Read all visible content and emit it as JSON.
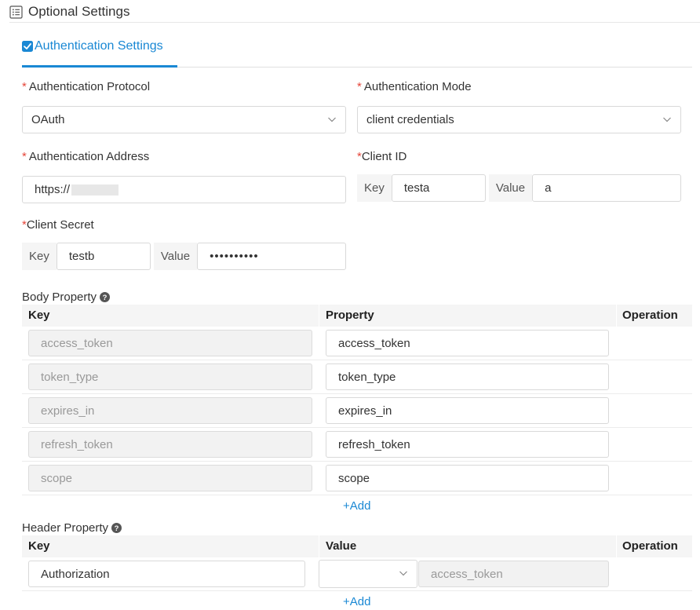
{
  "section": {
    "title": "Optional Settings",
    "icon": "list-icon"
  },
  "tab": {
    "label": "Authentication Settings",
    "checked": true,
    "color": "#1a88d4"
  },
  "fields": {
    "protocol": {
      "required": "*",
      "label": "Authentication Protocol",
      "value": "OAuth"
    },
    "mode": {
      "required": "*",
      "label": "Authentication Mode",
      "value": "client credentials"
    },
    "address": {
      "required": "*",
      "label": "Authentication Address",
      "value": "https://"
    },
    "client_id": {
      "required": "*",
      "label": "Client ID",
      "key_label": "Key",
      "key_value": "testa",
      "value_label": "Value",
      "value_value": "a"
    },
    "client_secret": {
      "required": "*",
      "label": "Client Secret",
      "key_label": "Key",
      "key_value": "testb",
      "value_label": "Value",
      "value_value": "••••••••••"
    }
  },
  "body_property": {
    "title": "Body Property",
    "columns": [
      "Key",
      "Property",
      "Operation"
    ],
    "rows": [
      {
        "key": "access_token",
        "property": "access_token"
      },
      {
        "key": "token_type",
        "property": "token_type"
      },
      {
        "key": "expires_in",
        "property": "expires_in"
      },
      {
        "key": "refresh_token",
        "property": "refresh_token"
      },
      {
        "key": "scope",
        "property": "scope"
      }
    ],
    "add_label": "+Add"
  },
  "header_property": {
    "title": "Header Property",
    "columns": [
      "Key",
      "Value",
      "Operation"
    ],
    "rows": [
      {
        "key": "Authorization",
        "select_value": "",
        "value": "access_token"
      }
    ],
    "add_label": "+Add"
  },
  "colors": {
    "required": "#e5463a",
    "link": "#1a88d4"
  }
}
